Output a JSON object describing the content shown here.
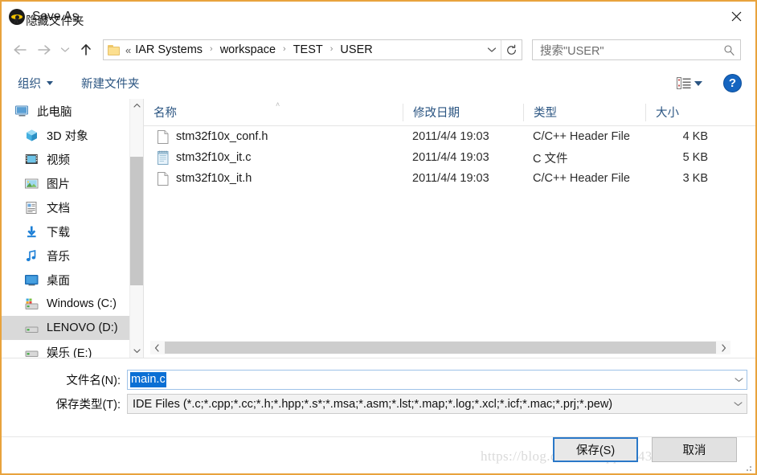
{
  "window": {
    "title": "Save As",
    "app_icon": "iar-workbench-icon",
    "close_label": "✕",
    "border_color": "#e8a33d"
  },
  "nav": {
    "back_icon": "arrow-left-icon",
    "forward_icon": "arrow-right-icon",
    "recent_icon": "chevron-down-icon",
    "up_icon": "arrow-up-icon",
    "breadcrumb": {
      "folder_icon": "folder-icon",
      "overflow": "«",
      "items": [
        "IAR Systems",
        "workspace",
        "TEST",
        "USER"
      ],
      "separator": "›",
      "caret_icon": "chevron-down-icon",
      "refresh_icon": "refresh-icon"
    },
    "search": {
      "placeholder": "搜索\"USER\"",
      "icon": "search-icon"
    }
  },
  "toolbar": {
    "organize_label": "组织",
    "new_folder_label": "新建文件夹",
    "view_icon": "list-view-icon",
    "view_caret_icon": "chevron-down-icon",
    "help_label": "?",
    "accent": "#2b5582"
  },
  "sidebar": {
    "items": [
      {
        "label": "此电脑",
        "icon": "this-pc-icon",
        "root": true,
        "selected": false
      },
      {
        "label": "3D 对象",
        "icon": "3d-objects-icon",
        "root": false,
        "selected": false
      },
      {
        "label": "视频",
        "icon": "videos-icon",
        "root": false,
        "selected": false
      },
      {
        "label": "图片",
        "icon": "pictures-icon",
        "root": false,
        "selected": false
      },
      {
        "label": "文档",
        "icon": "documents-icon",
        "root": false,
        "selected": false
      },
      {
        "label": "下载",
        "icon": "downloads-icon",
        "root": false,
        "selected": false
      },
      {
        "label": "音乐",
        "icon": "music-icon",
        "root": false,
        "selected": false
      },
      {
        "label": "桌面",
        "icon": "desktop-icon",
        "root": false,
        "selected": false
      },
      {
        "label": "Windows (C:)",
        "icon": "system-drive-icon",
        "root": false,
        "selected": false
      },
      {
        "label": "LENOVO (D:)",
        "icon": "drive-icon",
        "root": false,
        "selected": true
      },
      {
        "label": "娱乐 (E:)",
        "icon": "drive-icon",
        "root": false,
        "selected": false
      }
    ],
    "scroll_up_icon": "chevron-up-icon",
    "scroll_down_icon": "chevron-down-icon"
  },
  "filelist": {
    "columns": [
      {
        "key": "name",
        "label": "名称"
      },
      {
        "key": "date",
        "label": "修改日期"
      },
      {
        "key": "type",
        "label": "类型"
      },
      {
        "key": "size",
        "label": "大小"
      }
    ],
    "sort_indicator": "˄",
    "rows": [
      {
        "name": "stm32f10x_conf.h",
        "date": "2011/4/4 19:03",
        "type": "C/C++ Header File",
        "size": "4 KB",
        "icon": "header-file-icon"
      },
      {
        "name": "stm32f10x_it.c",
        "date": "2011/4/4 19:03",
        "type": "C 文件",
        "size": "5 KB",
        "icon": "c-source-file-icon"
      },
      {
        "name": "stm32f10x_it.h",
        "date": "2011/4/4 19:03",
        "type": "C/C++ Header File",
        "size": "3 KB",
        "icon": "header-file-icon"
      }
    ],
    "hscroll_left_icon": "chevron-left-icon",
    "hscroll_right_icon": "chevron-right-icon"
  },
  "form": {
    "filename_label": "文件名(N):",
    "filename_value": "main.c",
    "filename_selection_color": "#0b6fd4",
    "filetype_label": "保存类型(T):",
    "filetype_value": "IDE Files (*.c;*.cpp;*.cc;*.h;*.hpp;*.s*;*.msa;*.asm;*.lst;*.map;*.log;*.xcl;*.icf;*.mac;*.prj;*.pew)",
    "caret_icon": "chevron-down-icon"
  },
  "footer": {
    "hide_folders_label": "隐藏文件夹",
    "hide_folders_caret": "∧",
    "save_label": "保存(S)",
    "cancel_label": "取消",
    "focus_color": "#2a78c8"
  },
  "watermark": {
    "text": "https://blog.csdn.net/qq_39432978"
  }
}
